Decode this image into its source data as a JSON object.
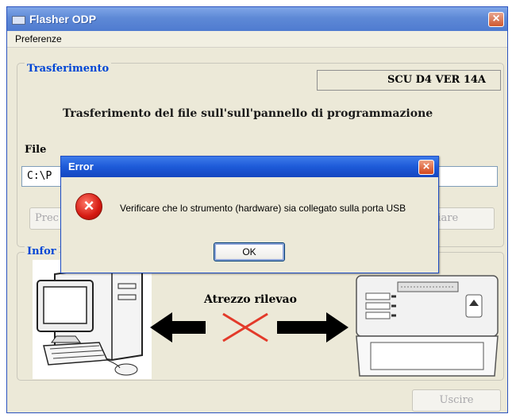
{
  "window": {
    "title": "Flasher ODP"
  },
  "menu": {
    "items": [
      "Preferenze"
    ]
  },
  "transfer": {
    "group_label": "Trasferimento",
    "version": "SCU D4 VER 14A",
    "heading": "Trasferimento del file sull'sull'pannello di programmazione",
    "file_label": "File",
    "file_path": "C:\\P",
    "left_button": "Prec",
    "right_button": "viare"
  },
  "info": {
    "group_label": "Infor",
    "status_label": "Atrezzo rilevao"
  },
  "footer": {
    "exit_button": "Uscire"
  },
  "dialog": {
    "title": "Error",
    "message": "Verificare che lo strumento (hardware) sia collegato sulla porta USB",
    "ok_label": "OK"
  },
  "colors": {
    "title_bar": "#5e89d6",
    "dialog_title": "#1d5ad8",
    "group_label": "#0046d5",
    "error_red": "#d51a12",
    "window_bg": "#ece9d8"
  }
}
